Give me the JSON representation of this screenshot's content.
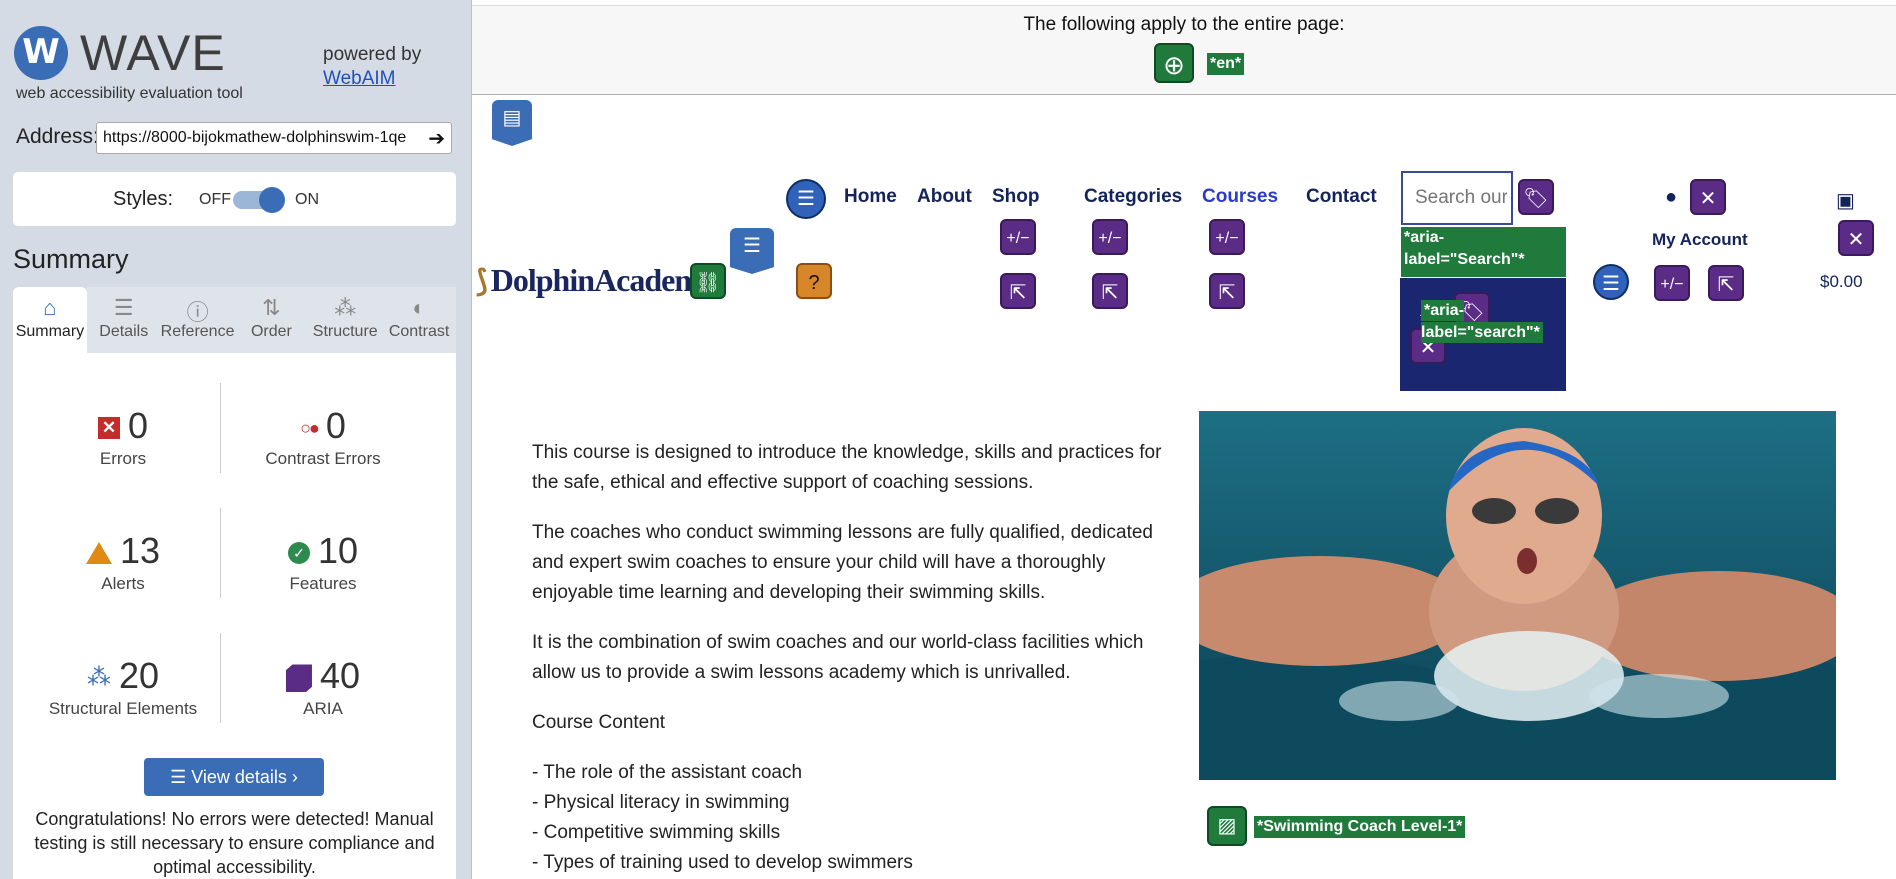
{
  "wave": {
    "logo_mark": "W",
    "logo_word": "WAVE",
    "tagline": "web accessibility evaluation tool",
    "powered_by": "powered by",
    "webaim_link": "WebAIM",
    "address_label": "Address:",
    "address_value": "https://8000-bijokmathew-dolphinswim-1qe",
    "styles_label": "Styles:",
    "styles_off": "OFF",
    "styles_on": "ON",
    "summary_heading": "Summary",
    "tabs": [
      {
        "label": "Summary",
        "icon": "⌂"
      },
      {
        "label": "Details",
        "icon": "☰"
      },
      {
        "label": "Reference",
        "icon": "ⓘ"
      },
      {
        "label": "Order",
        "icon": "⇅"
      },
      {
        "label": "Structure",
        "icon": "⁂"
      },
      {
        "label": "Contrast",
        "icon": "◐"
      }
    ],
    "stats": {
      "errors": {
        "value": "0",
        "label": "Errors"
      },
      "contrast": {
        "value": "0",
        "label": "Contrast Errors"
      },
      "alerts": {
        "value": "13",
        "label": "Alerts"
      },
      "features": {
        "value": "10",
        "label": "Features"
      },
      "structural": {
        "value": "20",
        "label": "Structural Elements"
      },
      "aria": {
        "value": "40",
        "label": "ARIA"
      }
    },
    "view_details": "View details ›",
    "congrats": "Congratulations! No errors were detected! Manual testing is still necessary to ensure compliance and optimal accessibility."
  },
  "page": {
    "banner_text": "The following apply to the entire page:",
    "lang_tag": "*en*",
    "nav": [
      "Home",
      "About",
      "Shop",
      "Categories",
      "Courses",
      "Contact"
    ],
    "search_placeholder": "Search our site",
    "aria_search_1": "*aria-label=\"Search\"*",
    "aria_search_2": "*aria-label=\"search\"*",
    "logo_text": "DolphinAcademy",
    "account_label": "My Account",
    "cart_price": "$0.00",
    "paragraphs": [
      "This course is designed to introduce the knowledge, skills and practices for the safe, ethical and effective support of coaching sessions.",
      "The coaches who conduct swimming lessons are fully qualified, dedicated and expert swim coaches to ensure your child will have a thoroughly enjoyable time learning and developing their swimming skills.",
      "It is the combination of swim coaches and our world-class facilities which allow us to provide a swim lessons academy which is unrivalled.",
      "Course Content"
    ],
    "course_items": [
      "- The role of the assistant coach",
      "- Physical literacy in swimming",
      "- Competitive swimming skills",
      "- Types of training used to develop swimmers"
    ],
    "image_caption": "*Swimming Coach Level-1*"
  },
  "colors": {
    "wave_blue": "#3a6db5",
    "aria_purple": "#5b2c86",
    "feature_green": "#1f7a3c",
    "nav_navy": "#14235a"
  }
}
